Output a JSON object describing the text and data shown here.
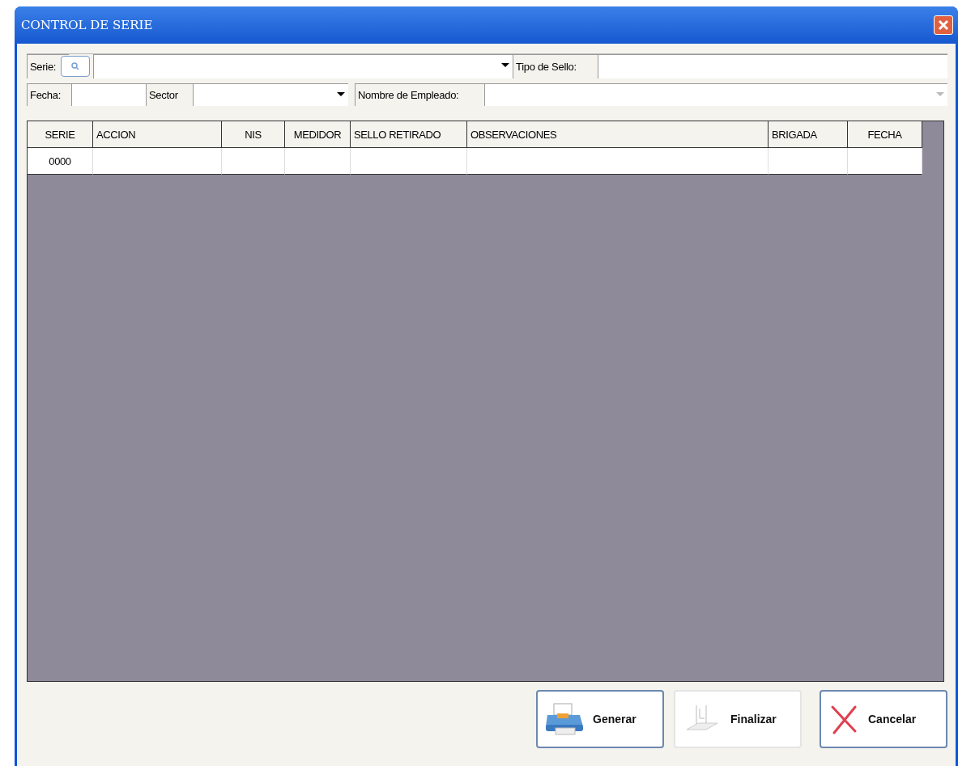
{
  "window": {
    "title": "CONTROL DE SERIE"
  },
  "filters": {
    "serie_label": "Serie:",
    "tipo_sello_label": "Tipo de Sello:",
    "fecha_label": "Fecha:",
    "sector_label": "Sector",
    "empleado_label": "Nombre de Empleado:",
    "empleado_disabled": true
  },
  "table": {
    "columns": [
      "SERIE",
      "ACCION",
      "NIS",
      "MEDIDOR",
      "SELLO RETIRADO",
      "OBSERVACIONES",
      "BRIGADA",
      "FECHA"
    ],
    "rows": [
      {
        "cells": [
          "0000"
        ]
      }
    ]
  },
  "buttons": [
    {
      "label": "Generar",
      "kind": "print",
      "disabled": false
    },
    {
      "label": "Finalizar",
      "kind": "finish",
      "disabled": true
    },
    {
      "label": "Cancelar",
      "kind": "cancel",
      "disabled": false
    }
  ]
}
